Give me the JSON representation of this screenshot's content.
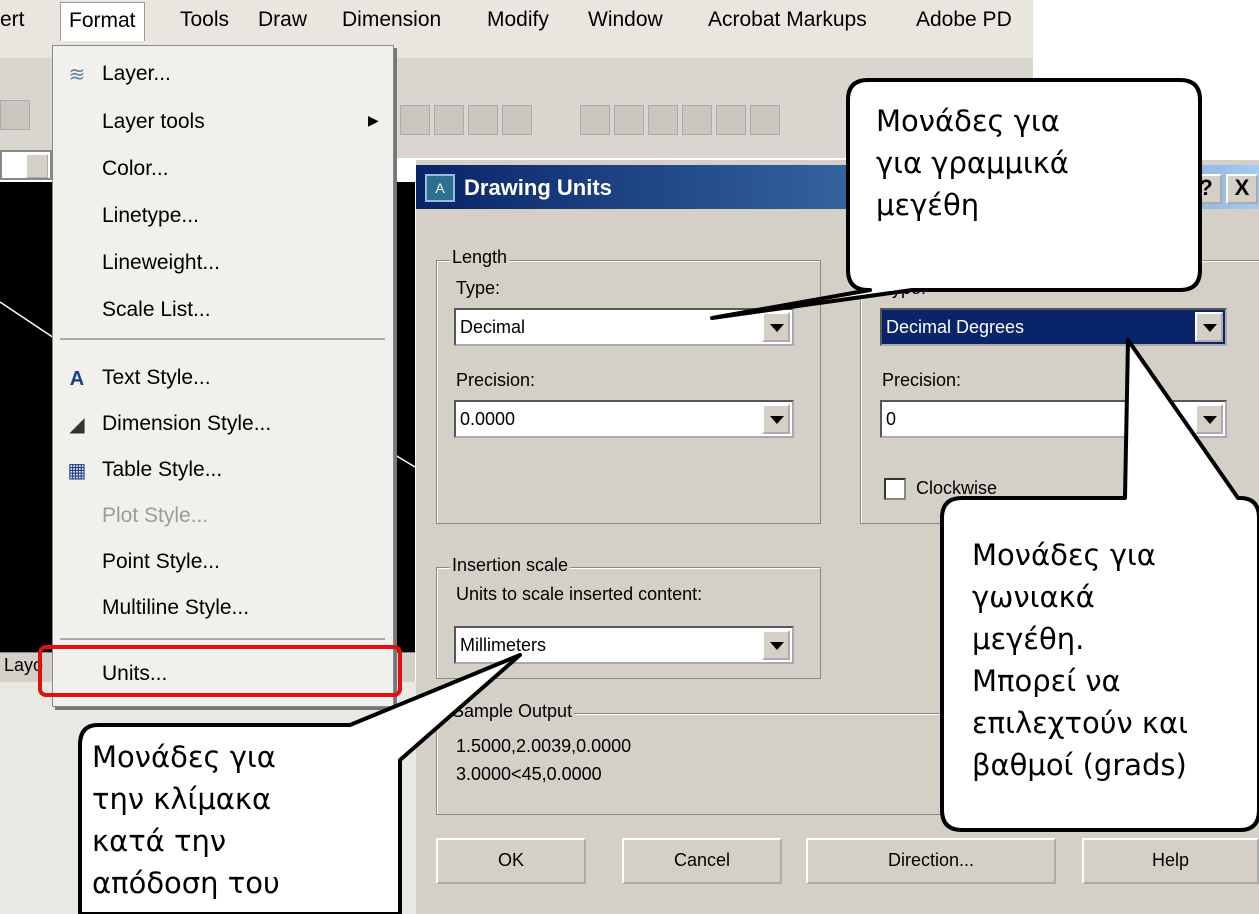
{
  "menubar": {
    "items": [
      "ert",
      "Format",
      "Tools",
      "Draw",
      "Dimension",
      "Modify",
      "Window",
      "Acrobat Markups",
      "Adobe PD"
    ]
  },
  "format_menu": {
    "items": [
      {
        "label": "Layer...",
        "icon": "layers-icon"
      },
      {
        "label": "Layer tools",
        "icon": "",
        "submenu": true
      },
      {
        "label": "Color...",
        "icon": ""
      },
      {
        "label": "Linetype...",
        "icon": ""
      },
      {
        "label": "Lineweight...",
        "icon": ""
      },
      {
        "label": "Scale List...",
        "icon": ""
      },
      {
        "label": "Text Style...",
        "icon": "text-style-icon"
      },
      {
        "label": "Dimension Style...",
        "icon": "dimension-style-icon"
      },
      {
        "label": "Table Style...",
        "icon": "table-style-icon"
      },
      {
        "label": "Plot Style...",
        "icon": "",
        "disabled": true
      },
      {
        "label": "Point Style...",
        "icon": ""
      },
      {
        "label": "Multiline Style...",
        "icon": ""
      },
      {
        "label": "Units...",
        "icon": ""
      }
    ],
    "layout_tab": "Layo"
  },
  "dialog": {
    "title": "Drawing Units",
    "length": {
      "group_label": "Length",
      "type_label": "Type:",
      "type_value": "Decimal",
      "precision_label": "Precision:",
      "precision_value": "0.0000"
    },
    "angle": {
      "type_label": "Type:",
      "type_value": "Decimal Degrees",
      "precision_label": "Precision:",
      "precision_value": "0",
      "clockwise_label": "Clockwise"
    },
    "insertion": {
      "group_label": "Insertion scale",
      "units_label": "Units to scale inserted content:",
      "units_value": "Millimeters"
    },
    "sample": {
      "group_label": "Sample Output",
      "line1": "1.5000,2.0039,0.0000",
      "line2": "3.0000<45,0.0000"
    },
    "buttons": {
      "ok": "OK",
      "cancel": "Cancel",
      "direction": "Direction...",
      "help": "Help",
      "help_title": "?",
      "close_title": "X"
    }
  },
  "callouts": {
    "linear": [
      "Μονάδες για",
      "για γραμμικά",
      "μεγέθη"
    ],
    "angular": [
      "Μονάδες για",
      "γωνιακά",
      "μεγέθη.",
      "Μπορεί να",
      "επιλεχτούν και",
      "βαθμοί (grads)"
    ],
    "insertion": [
      "Μονάδες για",
      "την κλίμακα",
      "κατά την",
      "απόδοση του"
    ]
  },
  "colors": {
    "highlight_box": "#e01010",
    "selection": "#0a246a"
  }
}
